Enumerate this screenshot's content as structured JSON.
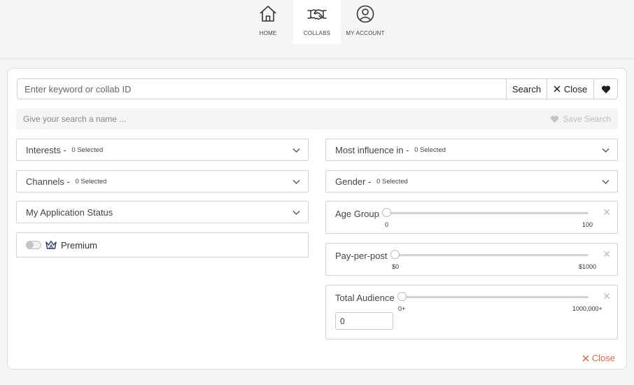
{
  "nav": {
    "items": [
      {
        "label": "HOME",
        "icon": "home-icon"
      },
      {
        "label": "COLLABS",
        "icon": "handshake-icon",
        "active": true
      },
      {
        "label": "MY ACCOUNT",
        "icon": "user-circle-icon"
      }
    ]
  },
  "search": {
    "placeholder": "Enter keyword or collab ID",
    "value": "",
    "search_label": "Search",
    "close_label": "Close"
  },
  "save": {
    "placeholder": "Give your search a name ...",
    "save_label": "Save Search"
  },
  "filters": {
    "interests": {
      "label": "Interests - ",
      "count": "0 Selected"
    },
    "channels": {
      "label": "Channels - ",
      "count": "0 Selected"
    },
    "application_status": {
      "label": "My Application Status"
    },
    "premium": {
      "label": "Premium",
      "enabled": false
    },
    "most_influence": {
      "label": "Most influence in - ",
      "count": "0 Selected"
    },
    "gender": {
      "label": "Gender - ",
      "count": "0 Selected"
    },
    "age_group": {
      "label": "Age Group",
      "min": "0",
      "max": "100",
      "value_fraction": 0
    },
    "pay_per_post": {
      "label": "Pay-per-post",
      "min": "$0",
      "max": "$1000",
      "value_fraction": 0
    },
    "total_audience": {
      "label": "Total Audience",
      "min": "0+",
      "max": "1000,000+",
      "value_fraction": 0,
      "input_value": "0"
    }
  },
  "footer": {
    "close_label": "Close"
  },
  "colors": {
    "accent_close": "#d86a4a",
    "active_tab": "#ffffff"
  }
}
